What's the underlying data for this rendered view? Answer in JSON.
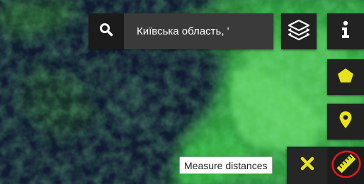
{
  "search": {
    "value": "Київська область, '"
  },
  "tooltip": {
    "text": "Measure distances"
  },
  "icons": {
    "search": "search-icon",
    "layers": "layers-icon",
    "info": "info-icon",
    "polygon": "pentagon-icon",
    "marker": "map-marker-icon",
    "close": "close-icon",
    "ruler": "ruler-icon"
  },
  "colors": {
    "accent": "#e8e21a",
    "toolbar_bg": "#222222",
    "highlight_circle": "#e0191f"
  }
}
